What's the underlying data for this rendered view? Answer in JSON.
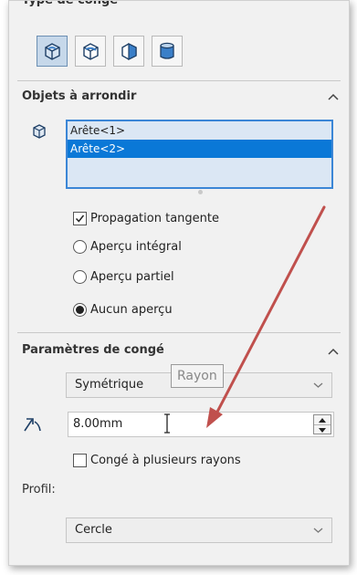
{
  "header": {
    "title": "Type de congé"
  },
  "fillet_types": [
    {
      "name": "constant-size-fillet",
      "active": true
    },
    {
      "name": "variable-size-fillet",
      "active": false
    },
    {
      "name": "face-fillet",
      "active": false
    },
    {
      "name": "full-round-fillet",
      "active": false
    }
  ],
  "items_section": {
    "title": "Objets à arrondir",
    "list": [
      "Arête<1>",
      "Arête<2>"
    ],
    "selected_index": 1,
    "propagation_label": "Propagation tangente",
    "propagation_checked": true,
    "preview_options": [
      "Aperçu intégral",
      "Aperçu partiel",
      "Aucun aperçu"
    ],
    "preview_selected": "Aucun aperçu"
  },
  "params_section": {
    "title": "Paramètres de congé",
    "method_value": "Symétrique",
    "tooltip": "Rayon",
    "radius_value": "8.00mm",
    "multi_radius_label": "Congé à plusieurs rayons",
    "multi_radius_checked": false,
    "profile_label": "Profil:",
    "profile_value": "Cercle"
  },
  "colors": {
    "selection_blue": "#0a78d7",
    "list_border": "#3b86d6",
    "annotation_arrow": "#c0504d"
  }
}
